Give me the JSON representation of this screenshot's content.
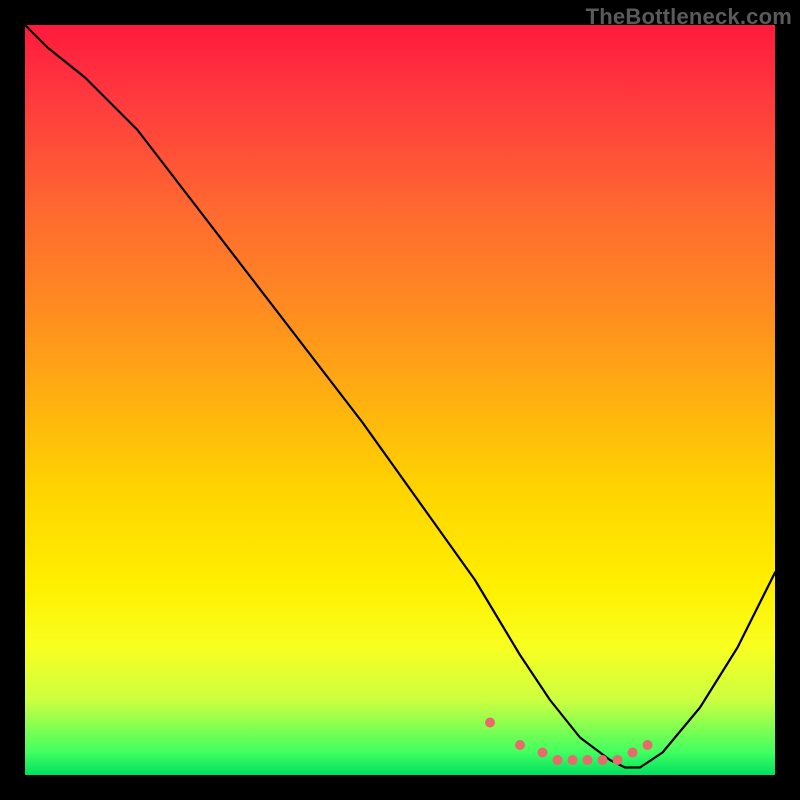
{
  "watermark": "TheBottleneck.com",
  "chart_data": {
    "type": "line",
    "title": "",
    "xlabel": "",
    "ylabel": "",
    "xlim": [
      0,
      100
    ],
    "ylim": [
      0,
      100
    ],
    "series": [
      {
        "name": "bottleneck-curve",
        "x": [
          0,
          3,
          8,
          15,
          25,
          35,
          45,
          55,
          60,
          63,
          66,
          70,
          74,
          78,
          80,
          82,
          85,
          90,
          95,
          100
        ],
        "values": [
          100,
          97,
          93,
          86,
          73,
          60,
          47,
          33,
          26,
          21,
          16,
          10,
          5,
          2,
          1,
          1,
          3,
          9,
          17,
          27
        ]
      }
    ],
    "markers": {
      "name": "optimal-range-markers",
      "x": [
        62,
        66,
        69,
        71,
        73,
        75,
        77,
        79,
        81,
        83
      ],
      "values": [
        7,
        4,
        3,
        2,
        2,
        2,
        2,
        2,
        3,
        4
      ]
    },
    "colors": {
      "curve": "#000000",
      "marker": "#e86a6a",
      "gradient_top": "#ff1a3d",
      "gradient_bottom": "#00e060"
    }
  }
}
